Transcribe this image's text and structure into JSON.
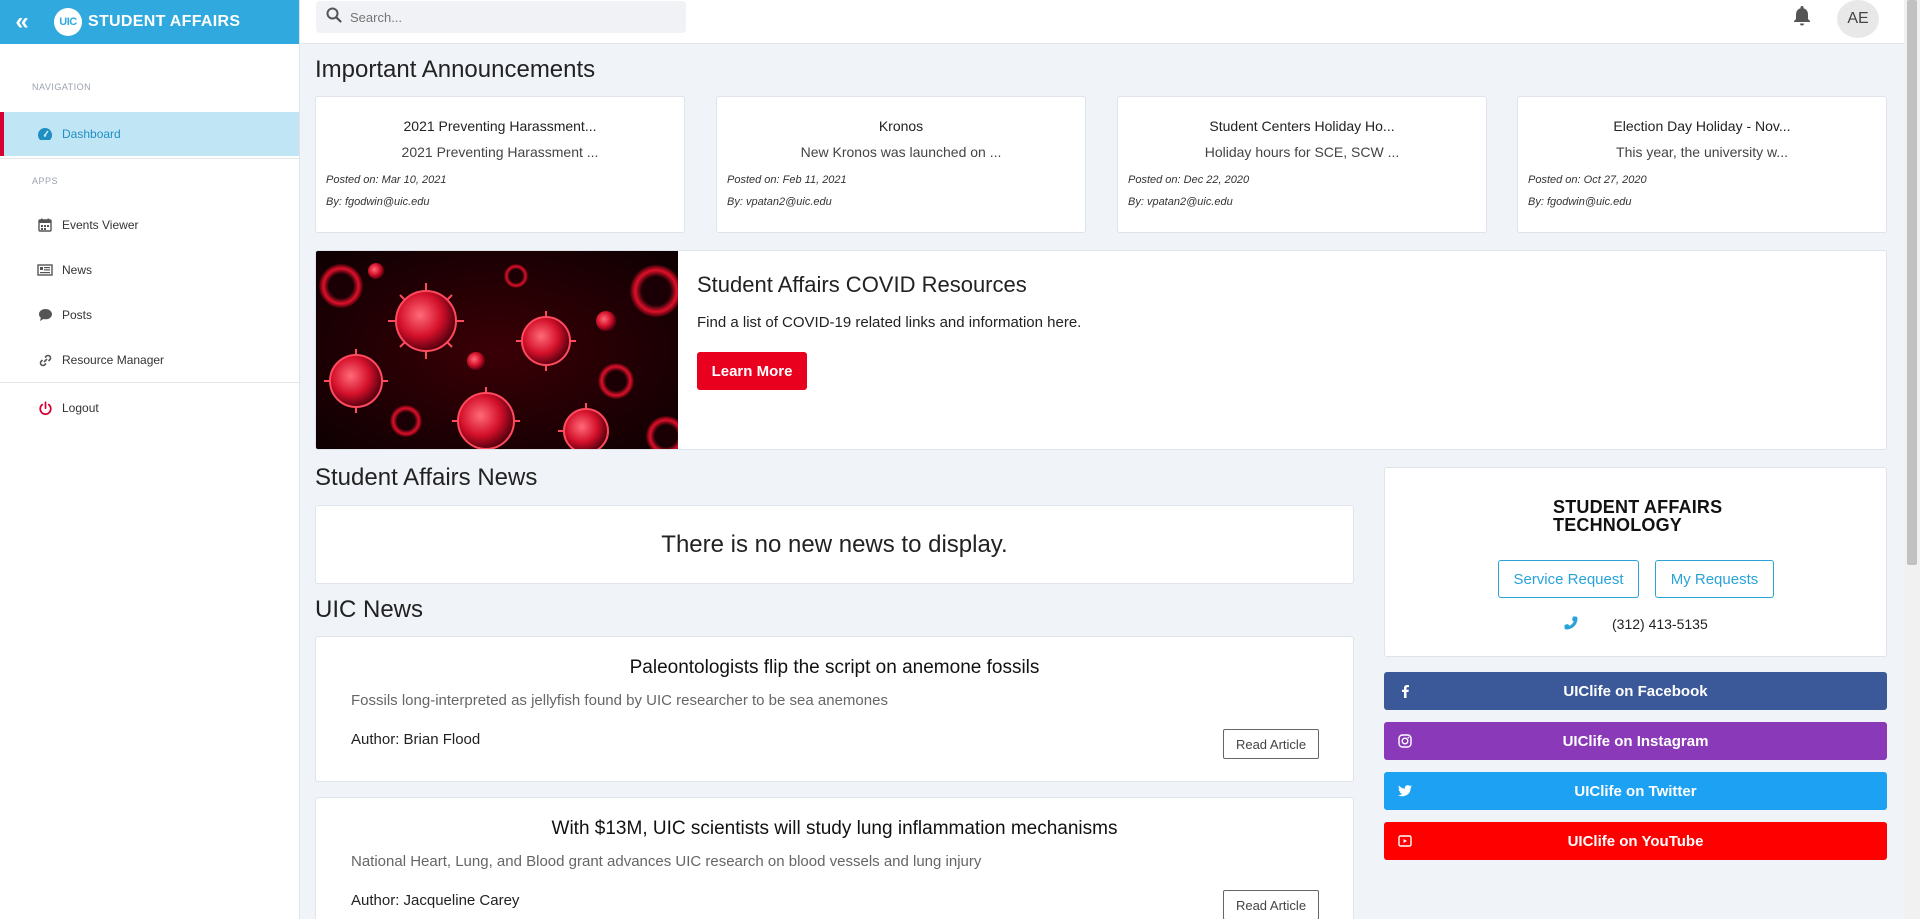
{
  "brand": {
    "logo_text": "UIC",
    "name": "STUDENT AFFAIRS"
  },
  "search": {
    "placeholder": "Search..."
  },
  "user": {
    "initials": "AE"
  },
  "sidebar": {
    "nav_header": "NAVIGATION",
    "apps_header": "APPS",
    "items": [
      {
        "label": "Dashboard",
        "icon": "dashboard-icon"
      },
      {
        "label": "Events Viewer",
        "icon": "calendar-icon"
      },
      {
        "label": "News",
        "icon": "newspaper-icon"
      },
      {
        "label": "Posts",
        "icon": "comment-icon"
      },
      {
        "label": "Resource Manager",
        "icon": "link-icon"
      },
      {
        "label": "Logout",
        "icon": "power-icon"
      }
    ]
  },
  "announcements": {
    "heading": "Important Announcements",
    "items": [
      {
        "title": "2021 Preventing Harassment...",
        "summary": "2021 Preventing Harassment ...",
        "date": "Posted on: Mar 10, 2021",
        "by": "By: fgodwin@uic.edu"
      },
      {
        "title": "Kronos",
        "summary": "New Kronos was launched on ...",
        "date": "Posted on: Feb 11, 2021",
        "by": "By: vpatan2@uic.edu"
      },
      {
        "title": "Student Centers Holiday Ho...",
        "summary": "Holiday hours for SCE, SCW ...",
        "date": "Posted on: Dec 22, 2020",
        "by": "By: vpatan2@uic.edu"
      },
      {
        "title": "Election Day Holiday - Nov...",
        "summary": "This year, the university w...",
        "date": "Posted on: Oct 27, 2020",
        "by": "By: fgodwin@uic.edu"
      }
    ]
  },
  "covid": {
    "title": "Student Affairs COVID Resources",
    "description": "Find a list of COVID-19 related links and information here.",
    "button": "Learn More"
  },
  "sa_news": {
    "heading": "Student Affairs News",
    "empty": "There is no new news to display."
  },
  "uic_news": {
    "heading": "UIC News",
    "button": "Read Article",
    "items": [
      {
        "title": "Paleontologists flip the script on anemone fossils",
        "subtitle": "Fossils long-interpreted as jellyfish found by UIC researcher to be sea anemones",
        "author": "Author: Brian Flood"
      },
      {
        "title": "With $13M, UIC scientists will study lung inflammation mechanisms",
        "subtitle": "National Heart, Lung, and Blood grant advances UIC research on blood vessels and lung injury",
        "author": "Author: Jacqueline Carey"
      }
    ]
  },
  "sat": {
    "logo_line1": "STUDENT AFFAIRS",
    "logo_line2": "TECHNOLOGY",
    "service_request": "Service Request",
    "my_requests": "My Requests",
    "phone": "(312) 413-5135"
  },
  "social": [
    {
      "label": "UIClife on Facebook",
      "icon": "facebook-icon",
      "color": "#3b5998"
    },
    {
      "label": "UIClife on Instagram",
      "icon": "instagram-icon",
      "color": "#8a3ab9"
    },
    {
      "label": "UIClife on Twitter",
      "icon": "twitter-icon",
      "color": "#1da1f2"
    },
    {
      "label": "UIClife on YouTube",
      "icon": "youtube-icon",
      "color": "#ff0000"
    }
  ],
  "colors": {
    "brand": "#2fa9de",
    "accent_red": "#e8001e",
    "active_bg": "#c0e6f5"
  }
}
